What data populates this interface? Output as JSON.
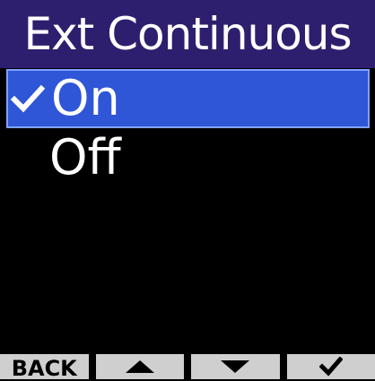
{
  "header": {
    "title": "Ext Continuous"
  },
  "menu": {
    "items": [
      {
        "label": "On",
        "checked": true,
        "selected": true,
        "icon": "checkmark-icon"
      },
      {
        "label": "Off",
        "checked": false,
        "selected": false
      }
    ]
  },
  "softkeys": {
    "back_label": "BACK",
    "up_icon": "triangle-up-icon",
    "down_icon": "triangle-down-icon",
    "confirm_icon": "checkmark-icon"
  },
  "colors": {
    "title_bg": "#2e1f6e",
    "selection_bg": "#2f56d6",
    "selection_border": "#7fa3ff",
    "softkey_bg": "#cfcfcf",
    "screen_bg": "#000000",
    "text": "#ffffff"
  }
}
